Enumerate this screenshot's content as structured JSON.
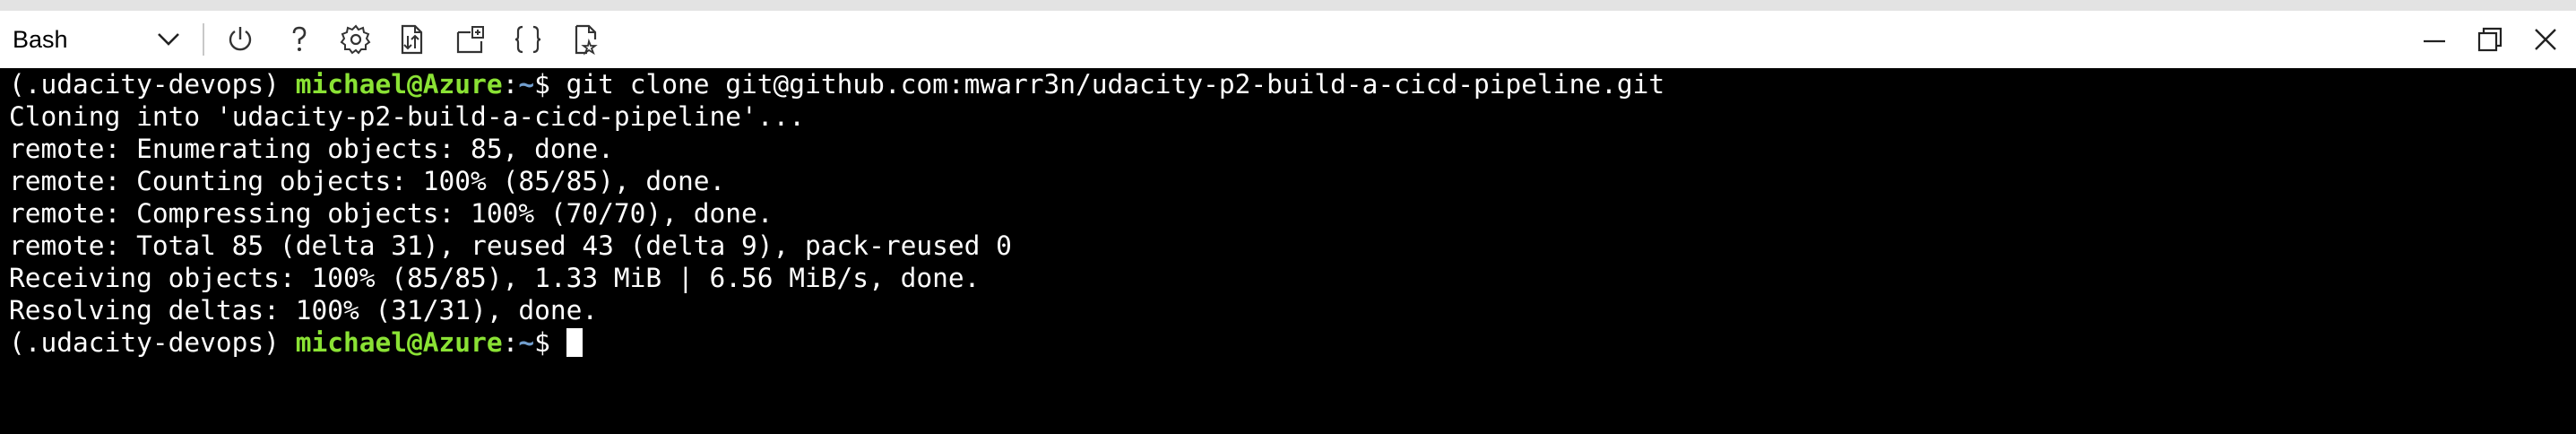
{
  "toolbar": {
    "shell_selected": "Bash",
    "icons": [
      "power-icon",
      "help-icon",
      "settings-icon",
      "upload-download-icon",
      "open-new-session-icon",
      "editor-braces-icon",
      "web-preview-icon"
    ],
    "window_controls": [
      "minimize-icon",
      "restore-icon",
      "close-icon"
    ]
  },
  "colors": {
    "user_host": "#8ae234",
    "path": "#729fcf",
    "terminal_bg": "#000000",
    "terminal_fg": "#ffffff"
  },
  "terminal": {
    "prompt_env": "(.udacity-devops) ",
    "prompt_user_host": "michael@Azure",
    "prompt_sep": ":",
    "prompt_path": "~",
    "prompt_symbol": "$ ",
    "command": "git clone git@github.com:mwarr3n/udacity-p2-build-a-cicd-pipeline.git",
    "output": [
      "Cloning into 'udacity-p2-build-a-cicd-pipeline'...",
      "remote: Enumerating objects: 85, done.",
      "remote: Counting objects: 100% (85/85), done.",
      "remote: Compressing objects: 100% (70/70), done.",
      "remote: Total 85 (delta 31), reused 43 (delta 9), pack-reused 0",
      "Receiving objects: 100% (85/85), 1.33 MiB | 6.56 MiB/s, done.",
      "Resolving deltas: 100% (31/31), done."
    ]
  }
}
